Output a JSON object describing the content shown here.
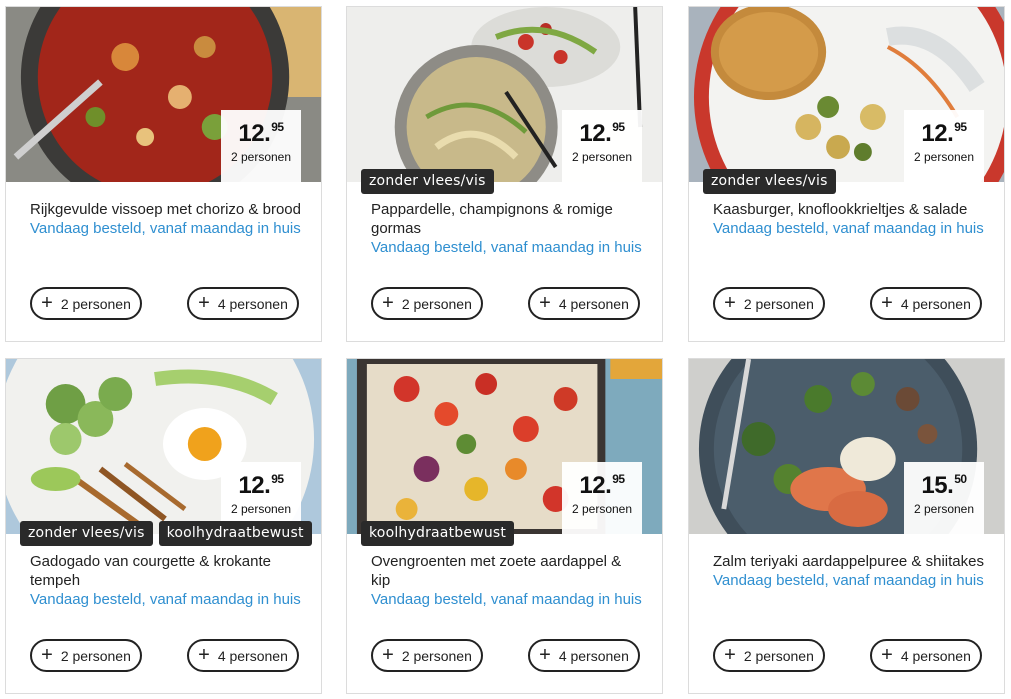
{
  "cards": [
    {
      "title": "Rijkgevulde vissoep met chorizo & brood",
      "delivery": "Vandaag besteld, vanaf maandag in huis",
      "price_main": "12.",
      "price_cents": "95",
      "price_sub": "2 personen",
      "tags": [],
      "button_left": "2 personen",
      "button_right": "4 personen"
    },
    {
      "title": "Pappardelle, champignons & romige gormas",
      "delivery": "Vandaag besteld, vanaf maandag in huis",
      "price_main": "12.",
      "price_cents": "95",
      "price_sub": "2 personen",
      "tags": [
        "zonder vlees/vis"
      ],
      "button_left": "2 personen",
      "button_right": "4 personen"
    },
    {
      "title": "Kaasburger, knoflookkrieltjes & salade",
      "delivery": "Vandaag besteld, vanaf maandag in huis",
      "price_main": "12.",
      "price_cents": "95",
      "price_sub": "2 personen",
      "tags": [
        "zonder vlees/vis"
      ],
      "button_left": "2 personen",
      "button_right": "4 personen"
    },
    {
      "title": "Gadogado van courgette & krokante tempeh",
      "delivery": "Vandaag besteld, vanaf maandag in huis",
      "price_main": "12.",
      "price_cents": "95",
      "price_sub": "2 personen",
      "tags": [
        "zonder vlees/vis",
        "koolhydraatbewust"
      ],
      "button_left": "2 personen",
      "button_right": "4 personen"
    },
    {
      "title": "Ovengroenten met zoete aardappel & kip",
      "delivery": "Vandaag besteld, vanaf maandag in huis",
      "price_main": "12.",
      "price_cents": "95",
      "price_sub": "2 personen",
      "tags": [
        "koolhydraatbewust"
      ],
      "button_left": "2 personen",
      "button_right": "4 personen"
    },
    {
      "title": "Zalm teriyaki aardappelpuree & shiitakes",
      "delivery": "Vandaag besteld, vanaf maandag in huis",
      "price_main": "15.",
      "price_cents": "50",
      "price_sub": "2 personen",
      "tags": [],
      "button_left": "2 personen",
      "button_right": "4 personen"
    }
  ],
  "plus_icon": "plus-icon",
  "colors": {
    "delivery": "#2f8fd0",
    "tag_bg": "#2a2a2a",
    "button_border": "#222222"
  }
}
